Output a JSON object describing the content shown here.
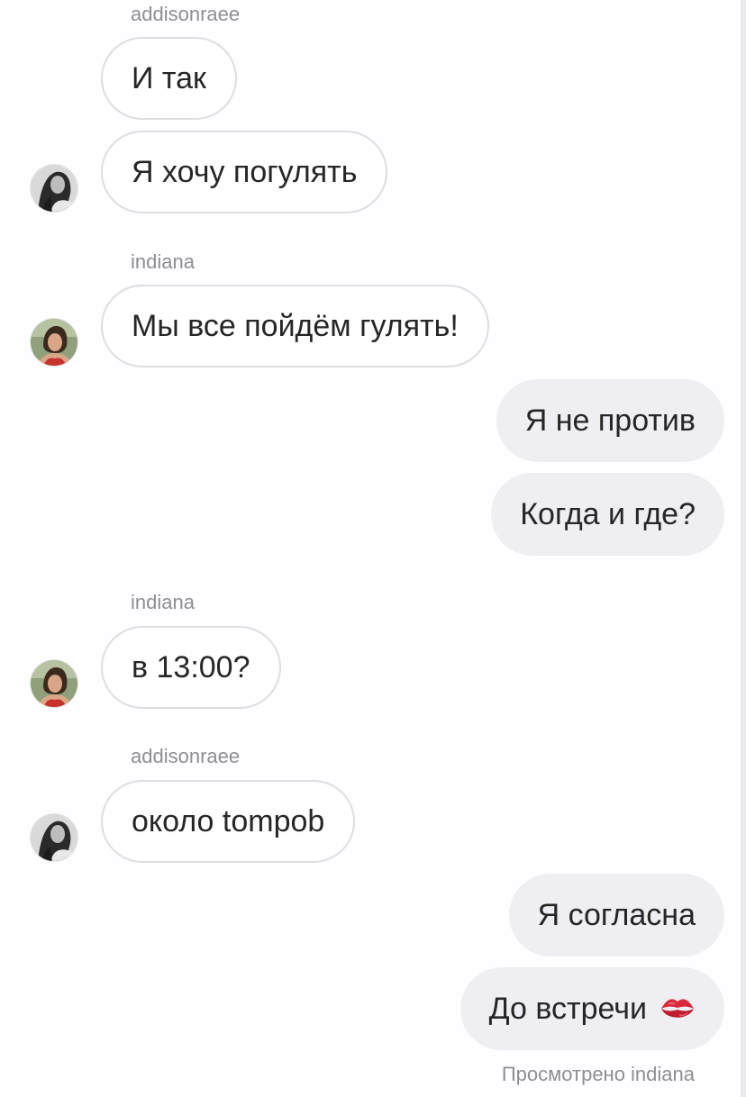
{
  "messages": [
    {
      "sender": "addisonraee"
    },
    {
      "text": "И так"
    },
    {
      "text": "Я хочу погулять"
    },
    {
      "sender": "indiana"
    },
    {
      "text": "Мы все пойдём гулять!"
    },
    {
      "text": "Я не против"
    },
    {
      "text": "Когда и где?"
    },
    {
      "sender": "indiana"
    },
    {
      "text": "в 13:00?"
    },
    {
      "sender": "addisonraee"
    },
    {
      "text": "около tompob"
    },
    {
      "text": "Я согласна"
    },
    {
      "text": "До встречи"
    }
  ],
  "icons": {
    "avatar_addisonraee": "avatar-addisonraee-icon",
    "avatar_indiana": "avatar-indiana-icon",
    "kiss_emoji": "kiss-lips-icon"
  },
  "seen_status": "Просмотрено indiana",
  "colors": {
    "incoming_bubble_border": "#dedde2",
    "outgoing_bubble_bg": "#efeff3",
    "meta_text": "#8e8e93",
    "message_text": "#262626",
    "kiss_red": "#d8283c"
  }
}
